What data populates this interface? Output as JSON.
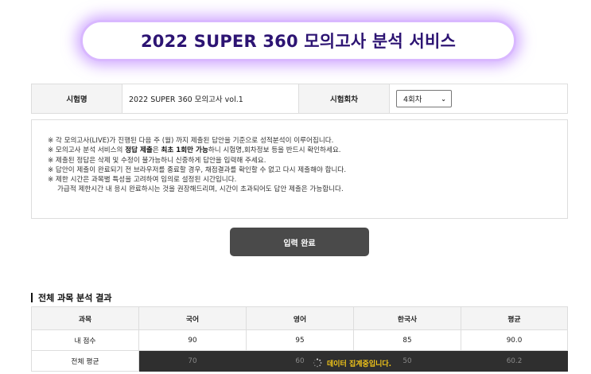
{
  "page": {
    "title": "2022 SUPER 360 모의고사 분석 서비스"
  },
  "info": {
    "exam_label": "시험명",
    "exam_value": "2022 SUPER 360 모의고사 vol.1",
    "round_label": "시험회차",
    "round_selected": "4회차"
  },
  "notice": {
    "lines": [
      "※ 각 모의고사(LIVE)가 진행된 다음 주 (월) 까지 제출된 답안을 기준으로 성적분석이 이루어집니다.",
      "※ 제출된 정답은 삭제 및 수정이 불가능하니 신중하게 답안을 입력해 주세요.",
      "※ 답안이 제출이 완료되기 전 브라우저를 종료할 경우, 채점결과를 확인할 수 없고 다시 제출해야 합니다.",
      "※ 제한 시간은 과목별 특성을 고려하여 임의로 설정된 시간입니다.",
      "가급적 제한시간 내 응시 완료하시는 것을 권장해드리며, 시간이 초과되어도 답안 제출은 가능합니다."
    ],
    "line2": {
      "pre": "※ 모의고사 분석 서비스의 ",
      "bold1": "정답 제출",
      "mid": "은 ",
      "bold2": "최초 1회만 가능",
      "post": "하니 시험명,회차정보 등을 반드시 확인하세요."
    }
  },
  "submit": {
    "label": "입력 완료"
  },
  "results": {
    "section_title": "전체 과목 분석 결과",
    "headers": [
      "과목",
      "국어",
      "영어",
      "한국사",
      "평균"
    ],
    "my_score": {
      "label": "내 점수",
      "values": [
        "90",
        "95",
        "85",
        "90.0"
      ]
    },
    "overall_avg": {
      "label": "전체 평균",
      "values": [
        "70",
        "60",
        "50",
        "60.2"
      ]
    },
    "loading_text": "데이터 집계중입니다."
  }
}
